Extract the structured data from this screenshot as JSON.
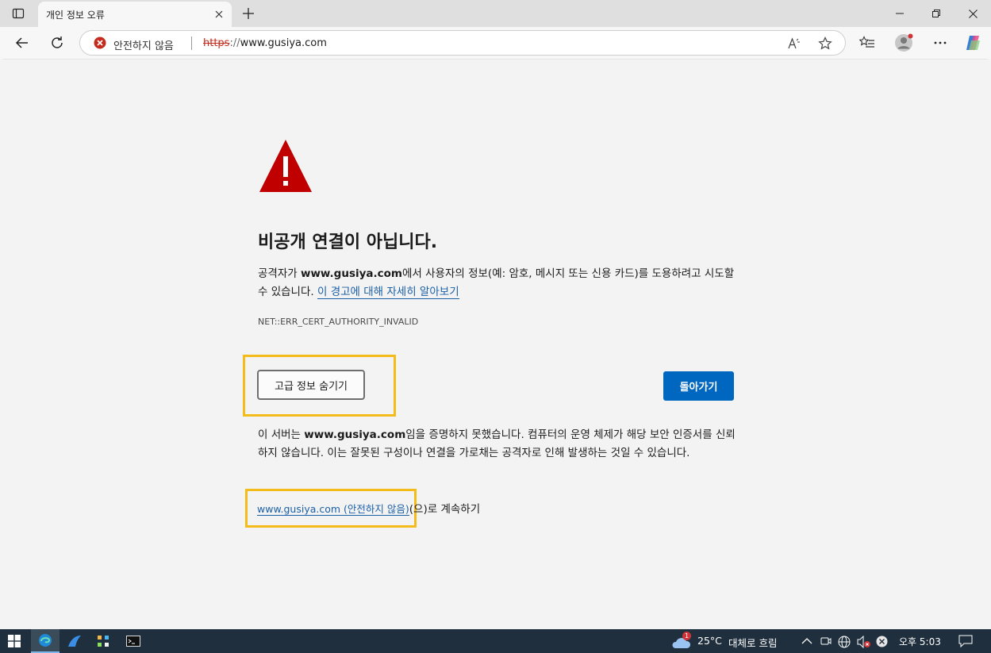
{
  "tab": {
    "title": "개인 정보 오류"
  },
  "address_bar": {
    "security_label": "안전하지 않음",
    "url_scheme": "https",
    "url_slashes": "://",
    "url_host": "www.gusiya.com"
  },
  "error_page": {
    "heading": "비공개 연결이 아닙니다.",
    "description_prefix": "공격자가 ",
    "description_host": "www.gusiya.com",
    "description_suffix": "에서 사용자의 정보(예: 암호, 메시지 또는 신용 카드)를 도용하려고 시도할 수 있습니다. ",
    "learn_more_link": "이 경고에 대해 자세히 알아보기",
    "error_code": "NET::ERR_CERT_AUTHORITY_INVALID",
    "hide_advanced_button": "고급 정보 숨기기",
    "back_button": "돌아가기",
    "advanced_prefix": "이 서버는 ",
    "advanced_host": "www.gusiya.com",
    "advanced_suffix": "임을 증명하지 못했습니다. 컴퓨터의 운영 체제가 해당 보안 인증서를 신뢰하지 않습니다. 이는 잘못된 구성이나 연결을 가로채는 공격자로 인해 발생하는 것일 수 있습니다.",
    "proceed_link": "www.gusiya.com (안전하지 않음)",
    "proceed_suffix": "(으)로 계속하기"
  },
  "taskbar": {
    "weather_badge": "1",
    "temperature": "25°C",
    "weather": "대체로 흐림",
    "clock": "오후 5:03"
  },
  "colors": {
    "warning_red": "#c00000",
    "primary_blue": "#0067c0",
    "link_blue": "#1a5fa6",
    "highlight_yellow": "#f4bc1a"
  }
}
